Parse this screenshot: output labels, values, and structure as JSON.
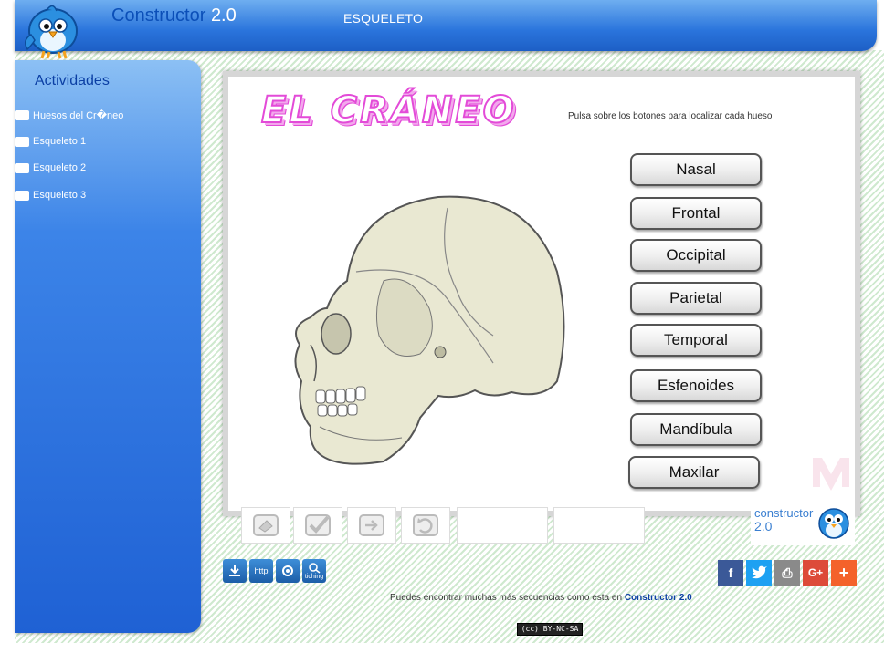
{
  "header": {
    "app_name": "Constructor",
    "app_version": "2.0",
    "section": "ESQUELETO"
  },
  "sidebar": {
    "heading": "Actividades",
    "items": [
      {
        "label": "Huesos del Cr�neo"
      },
      {
        "label": "Esqueleto 1"
      },
      {
        "label": "Esqueleto 2"
      },
      {
        "label": "Esqueleto 3"
      }
    ]
  },
  "activity": {
    "title": "EL CRÁNEO",
    "instruction": "Pulsa sobre los botones para localizar cada hueso",
    "bones": [
      {
        "label": "Nasal"
      },
      {
        "label": "Frontal"
      },
      {
        "label": "Occipital"
      },
      {
        "label": "Parietal"
      },
      {
        "label": "Temporal"
      },
      {
        "label": "Esfenoides"
      },
      {
        "label": "Mandíbula"
      },
      {
        "label": "Maxilar"
      }
    ]
  },
  "toolbar": {
    "tools": [
      {
        "icon": "eraser-icon"
      },
      {
        "icon": "check-icon"
      },
      {
        "icon": "next-icon"
      },
      {
        "icon": "undo-icon"
      }
    ]
  },
  "brand": {
    "name": "constructor",
    "version": "2.0"
  },
  "share": {
    "left_icons": [
      {
        "icon": "download-icon",
        "label": ""
      },
      {
        "icon": "http-icon",
        "label": "http"
      },
      {
        "icon": "scorm-icon",
        "label": ""
      },
      {
        "icon": "tiching-icon",
        "label": "tiching"
      }
    ],
    "social": [
      {
        "icon": "facebook-icon",
        "glyph": "f",
        "color": "#3b5998"
      },
      {
        "icon": "twitter-icon",
        "glyph": "t",
        "color": "#1da1f2"
      },
      {
        "icon": "print-icon",
        "glyph": "⎙",
        "color": "#8a8a8a"
      },
      {
        "icon": "google-plus-icon",
        "glyph": "G+",
        "color": "#dd4b39"
      },
      {
        "icon": "more-icon",
        "glyph": "+",
        "color": "#f4622b"
      }
    ]
  },
  "footer": {
    "text": "Puedes encontrar muchas más secuencias como esta en",
    "link": "Constructor 2.0",
    "license": "(cc) BY-NC-SA"
  }
}
